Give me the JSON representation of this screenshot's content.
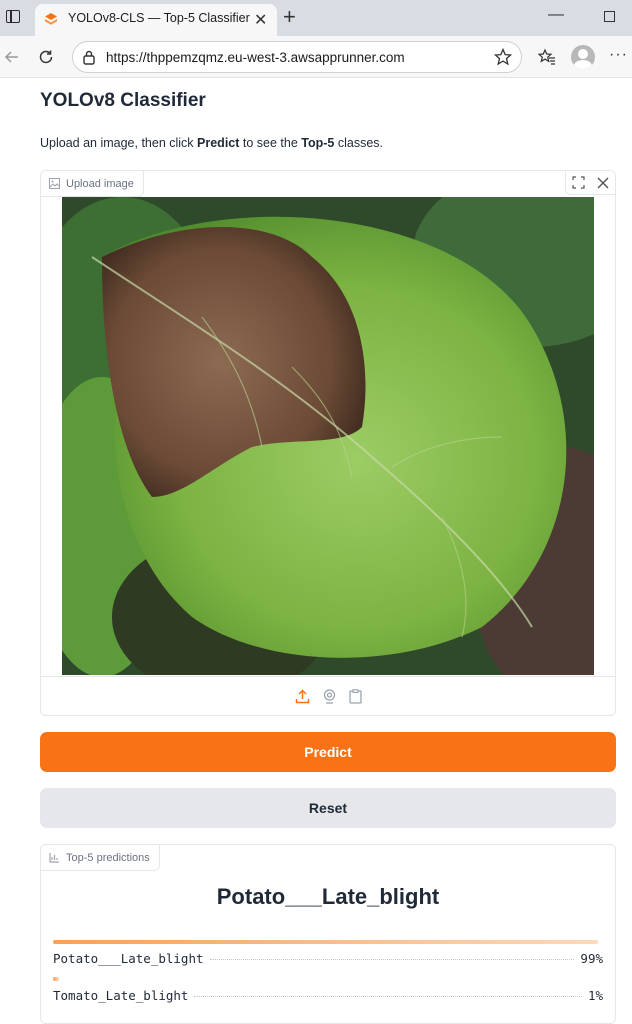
{
  "browser": {
    "tab_title": "YOLOv8-CLS — Top-5 Classifier",
    "url": "https://thppemzqmz.eu-west-3.awsapprunner.com"
  },
  "page": {
    "title": "YOLOv8 Classifier",
    "description": {
      "part1": "Upload an image, then click ",
      "bold1": "Predict",
      "part2": " to see the ",
      "bold2": "Top-5",
      "part3": " classes."
    }
  },
  "upload": {
    "label": "Upload image",
    "icons": [
      "fullscreen-icon",
      "close-icon",
      "upload-icon",
      "webcam-icon",
      "clipboard-icon"
    ]
  },
  "buttons": {
    "predict": "Predict",
    "reset": "Reset"
  },
  "predictions": {
    "label": "Top-5 predictions",
    "top_label": "Potato___Late_blight",
    "items": [
      {
        "label": "Potato___Late_blight",
        "confidence": "99%",
        "fraction": 0.99
      },
      {
        "label": "Tomato_Late_blight",
        "confidence": "1%",
        "fraction": 0.01
      }
    ]
  },
  "colors": {
    "accent": "#f97316",
    "reset_bg": "#e5e7eb"
  }
}
